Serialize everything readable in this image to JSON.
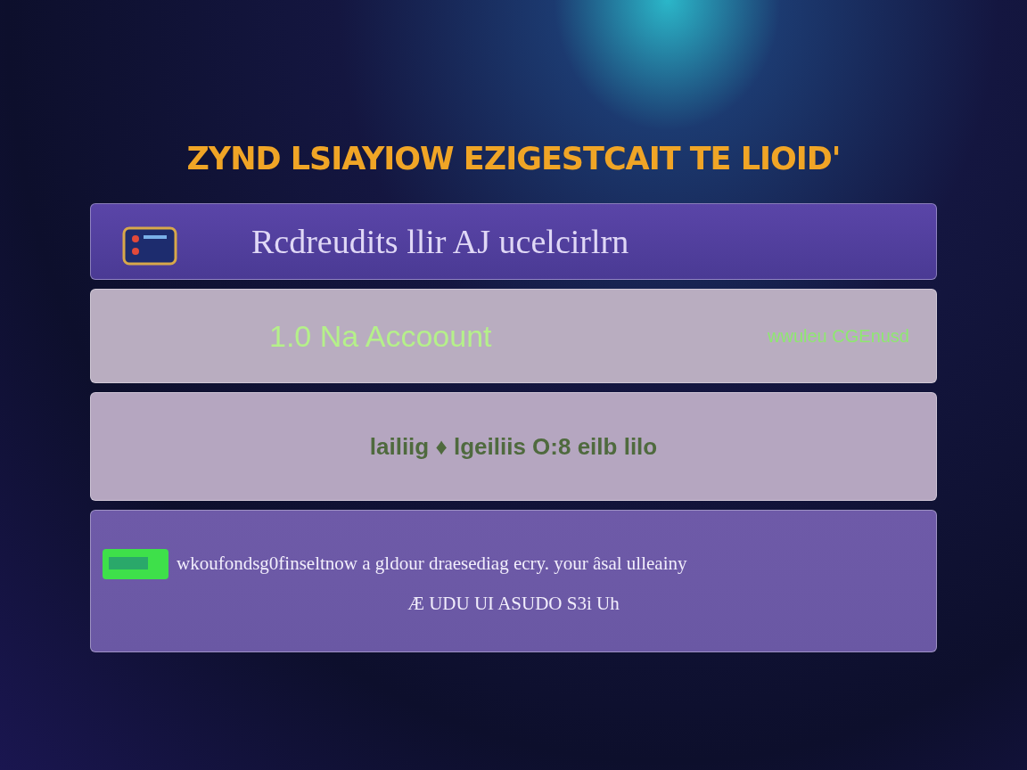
{
  "title": "ZYND LSIAYIOW EZIGESTCAIT TE LIOID'",
  "header_card": {
    "label": "Rcdreudits llir AJ ucelcirlrn"
  },
  "account_card": {
    "label": "1.0 Na Accoount",
    "note": "wwuleu CGEnusd"
  },
  "blur_card": {
    "label": "lailiig ♦ lgeiliis O:8 eilb lilo"
  },
  "message_card": {
    "text": "wkoufondsg0finseltnow a gldour draesediag ecry. your âsal ulleainy",
    "subtext": "Æ UDU UI ASUDO S3i Uh"
  }
}
